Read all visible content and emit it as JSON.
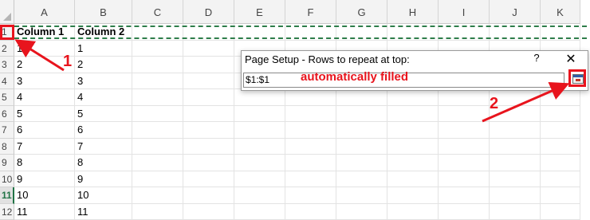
{
  "columns": [
    "A",
    "B",
    "C",
    "D",
    "E",
    "F",
    "G",
    "H",
    "I",
    "J",
    "K"
  ],
  "rows": [
    {
      "num": "1",
      "a": "Column 1",
      "b": "Column 2"
    },
    {
      "num": "2",
      "a": "1",
      "b": "1"
    },
    {
      "num": "3",
      "a": "2",
      "b": "2"
    },
    {
      "num": "4",
      "a": "3",
      "b": "3"
    },
    {
      "num": "5",
      "a": "4",
      "b": "4"
    },
    {
      "num": "6",
      "a": "5",
      "b": "5"
    },
    {
      "num": "7",
      "a": "6",
      "b": "6"
    },
    {
      "num": "8",
      "a": "7",
      "b": "7"
    },
    {
      "num": "9",
      "a": "8",
      "b": "8"
    },
    {
      "num": "10",
      "a": "9",
      "b": "9"
    },
    {
      "num": "11",
      "a": "10",
      "b": "10"
    },
    {
      "num": "12",
      "a": "11",
      "b": "11"
    }
  ],
  "selected_row": "11",
  "dialog": {
    "title": "Page Setup - Rows to repeat at top:",
    "help": "?",
    "close": "✕",
    "input_value": "$1:$1",
    "collapse_icon": "collapse-dialog-icon"
  },
  "annotations": {
    "step1": "1",
    "step2": "2",
    "note": "automatically filled"
  },
  "colors": {
    "annotation_red": "#e8141d",
    "marquee_green": "#2e7d4a",
    "selected_row_green": "#217346"
  }
}
